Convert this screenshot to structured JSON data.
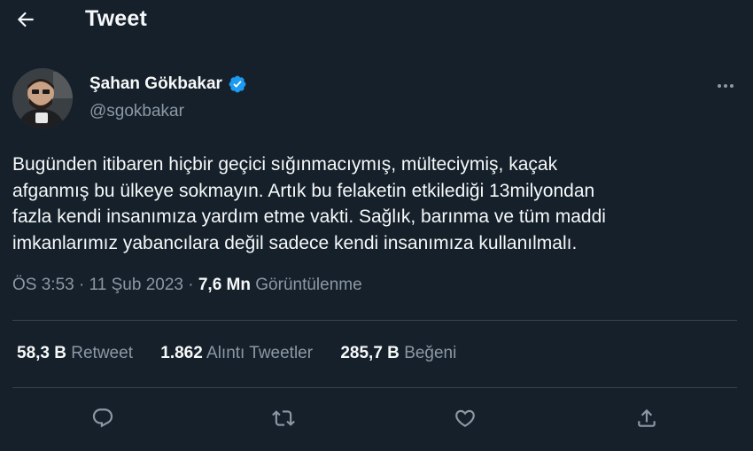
{
  "header": {
    "back_icon": "arrow-left-icon",
    "title": "Tweet"
  },
  "author": {
    "name": "Şahan Gökbakar",
    "handle": "@sgokbakar",
    "verified_icon": "verified-badge-icon",
    "verified_color": "#1d9bf0"
  },
  "tweet": {
    "lines": [
      "Bugünden itibaren hiçbir geçici sığınmacıymış, mülteciymiş, kaçak",
      "afganmış bu ülkeye sokmayın. Artık bu felaketin etkilediği 13milyondan",
      "fazla kendi insanımıza yardım etme vakti. Sağlık, barınma ve tüm maddi",
      "imkanlarımız yabancılara değil sadece kendi insanımıza kullanılmalı."
    ],
    "time": "ÖS 3:53",
    "separator": "·",
    "date": "11 Şub 2023",
    "views_count": "7,6 Mn",
    "views_label": "Görüntülenme"
  },
  "stats": {
    "retweets_count": "58,3 B",
    "retweets_label": "Retweet",
    "quotes_count": "1.862",
    "quotes_label": "Alıntı Tweetler",
    "likes_count": "285,7 B",
    "likes_label": "Beğeni"
  },
  "actions": [
    {
      "name": "reply",
      "icon": "reply-icon"
    },
    {
      "name": "retweet",
      "icon": "retweet-icon"
    },
    {
      "name": "like",
      "icon": "heart-icon"
    },
    {
      "name": "share",
      "icon": "share-icon"
    }
  ],
  "colors": {
    "background": "#15202b",
    "primary_text": "#f7f9f9",
    "secondary_text": "#8b98a5",
    "divider": "#38444d",
    "accent": "#1d9bf0"
  }
}
